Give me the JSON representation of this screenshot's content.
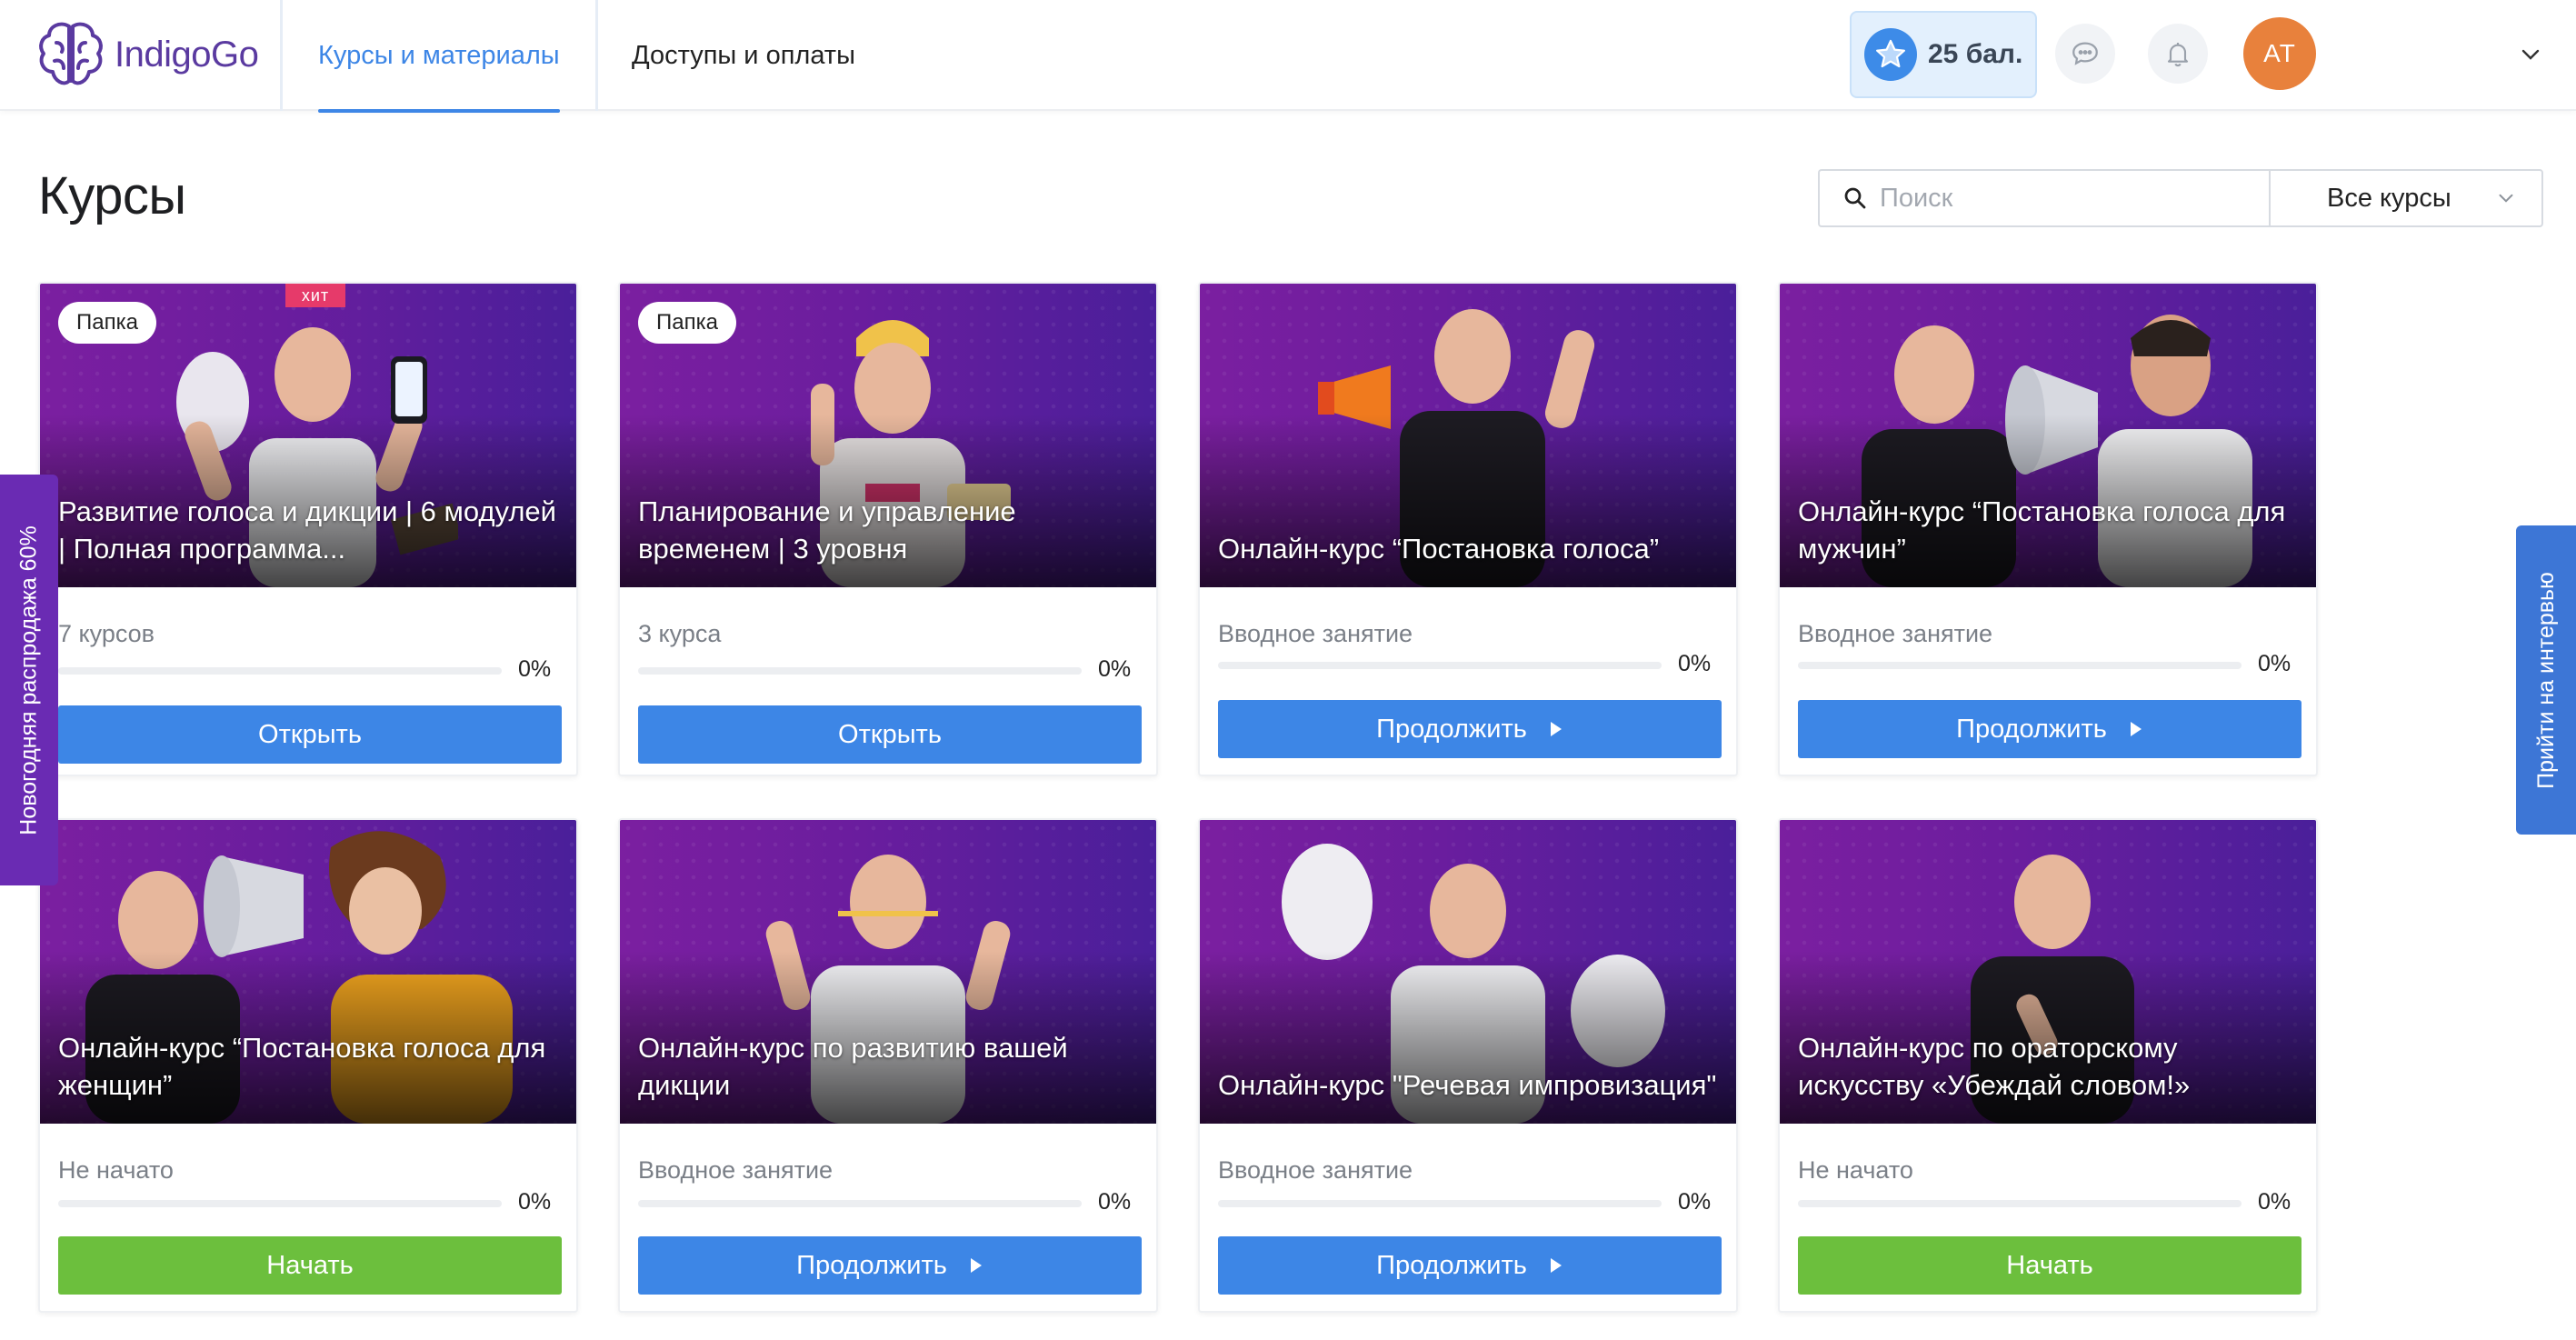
{
  "header": {
    "logo_text": "IndigoGo",
    "tabs": [
      {
        "label": "Курсы и материалы",
        "active": true
      },
      {
        "label": "Доступы и оплаты",
        "active": false
      }
    ],
    "points_label": "25 бал.",
    "avatar_initials": "AT"
  },
  "page": {
    "title": "Курсы",
    "search_placeholder": "Поиск",
    "filter_value": "Все курсы"
  },
  "cards": [
    {
      "title": "Развитие голоса и дикции | 6 модулей | Полная программа...",
      "subtitle": "7 курсов",
      "progress": 0,
      "progress_label": "0%",
      "button": "Открыть",
      "button_style": "blue",
      "folder_tag": "Папка",
      "hit_tag": "хит"
    },
    {
      "title": "Планирование и управление временем | 3 уровня",
      "subtitle": "3 курса",
      "progress": 0,
      "progress_label": "0%",
      "button": "Открыть",
      "button_style": "blue",
      "folder_tag": "Папка"
    },
    {
      "title": "Онлайн-курс “Постановка голоса”",
      "subtitle": "Вводное занятие",
      "progress": 0,
      "progress_label": "0%",
      "button": "Продолжить",
      "button_style": "blue"
    },
    {
      "title": "Онлайн-курс “Постановка голоса для мужчин”",
      "subtitle": "Вводное занятие",
      "progress": 0,
      "progress_label": "0%",
      "button": "Продолжить",
      "button_style": "blue"
    },
    {
      "title": "Онлайн-курс “Постановка голоса для женщин”",
      "subtitle": "Не начато",
      "progress": 0,
      "progress_label": "0%",
      "button": "Начать",
      "button_style": "green"
    },
    {
      "title": "Онлайн-курс по развитию вашей дикции",
      "subtitle": "Вводное занятие",
      "progress": 0,
      "progress_label": "0%",
      "button": "Продолжить",
      "button_style": "blue"
    },
    {
      "title": "Онлайн-курс \"Речевая импровизация\"",
      "subtitle": "Вводное занятие",
      "progress": 0,
      "progress_label": "0%",
      "button": "Продолжить",
      "button_style": "blue"
    },
    {
      "title": "Онлайн-курс по ораторскому искусству «Убеждай словом!»",
      "subtitle": "Не начато",
      "progress": 0,
      "progress_label": "0%",
      "button": "Начать",
      "button_style": "green"
    }
  ],
  "side_tabs": {
    "left": "Новогодняя распродажа 60%",
    "right": "Прийти на интервью"
  },
  "colors": {
    "accent": "#3d86e6",
    "start_green": "#6cbf3d",
    "promo_purple": "#6a2bb3",
    "interview_blue": "#3d76d6",
    "avatar": "#e8813c",
    "logo": "#5a3aa0"
  }
}
